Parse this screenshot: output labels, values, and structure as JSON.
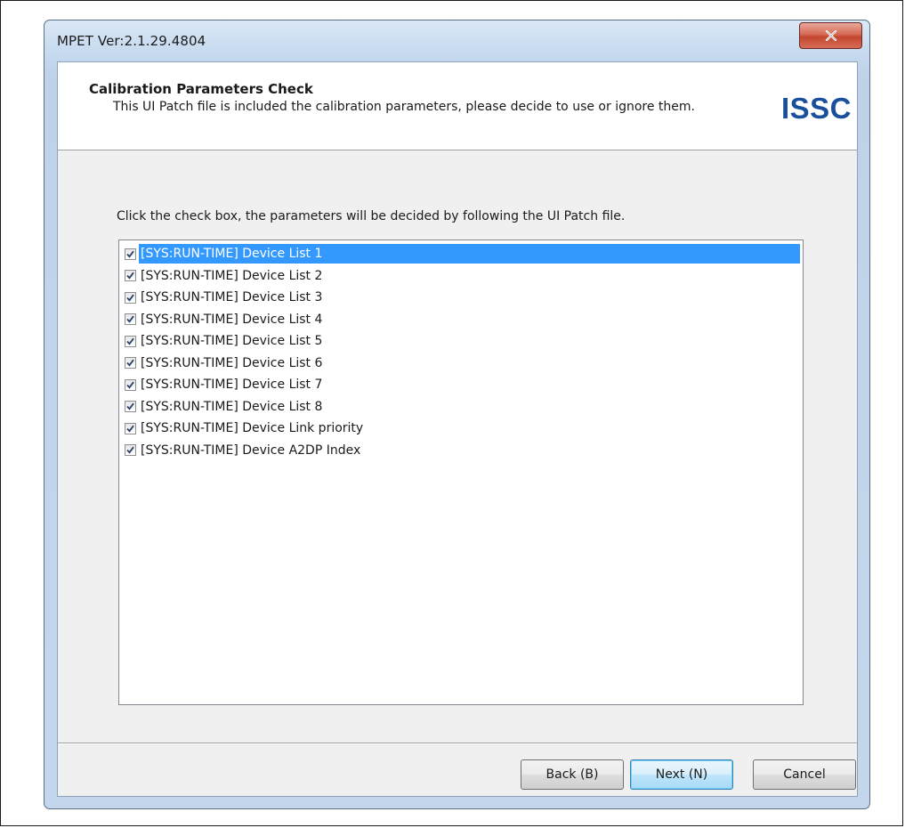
{
  "window": {
    "title": "MPET Ver:2.1.29.4804",
    "close_glyph": "x"
  },
  "header": {
    "title": "Calibration Parameters Check",
    "subtitle": "This UI Patch file is included the calibration parameters, please decide to use or ignore them.",
    "logo_text": "ISSC",
    "logo_color": "#1a4f9c"
  },
  "main": {
    "instruction": "Click the check box, the parameters will be decided by following the UI Patch file.",
    "items": [
      {
        "label": "[SYS:RUN-TIME] Device List 1",
        "checked": true,
        "selected": true
      },
      {
        "label": "[SYS:RUN-TIME] Device List 2",
        "checked": true,
        "selected": false
      },
      {
        "label": "[SYS:RUN-TIME] Device List 3",
        "checked": true,
        "selected": false
      },
      {
        "label": "[SYS:RUN-TIME] Device List 4",
        "checked": true,
        "selected": false
      },
      {
        "label": "[SYS:RUN-TIME] Device List 5",
        "checked": true,
        "selected": false
      },
      {
        "label": "[SYS:RUN-TIME] Device List 6",
        "checked": true,
        "selected": false
      },
      {
        "label": "[SYS:RUN-TIME] Device List 7",
        "checked": true,
        "selected": false
      },
      {
        "label": "[SYS:RUN-TIME] Device List 8",
        "checked": true,
        "selected": false
      },
      {
        "label": "[SYS:RUN-TIME] Device Link priority",
        "checked": true,
        "selected": false
      },
      {
        "label": "[SYS:RUN-TIME] Device A2DP Index",
        "checked": true,
        "selected": false
      }
    ],
    "selection_color": "#3399ff"
  },
  "footer": {
    "back_label": "Back (B)",
    "next_label": "Next (N)",
    "cancel_label": "Cancel"
  }
}
